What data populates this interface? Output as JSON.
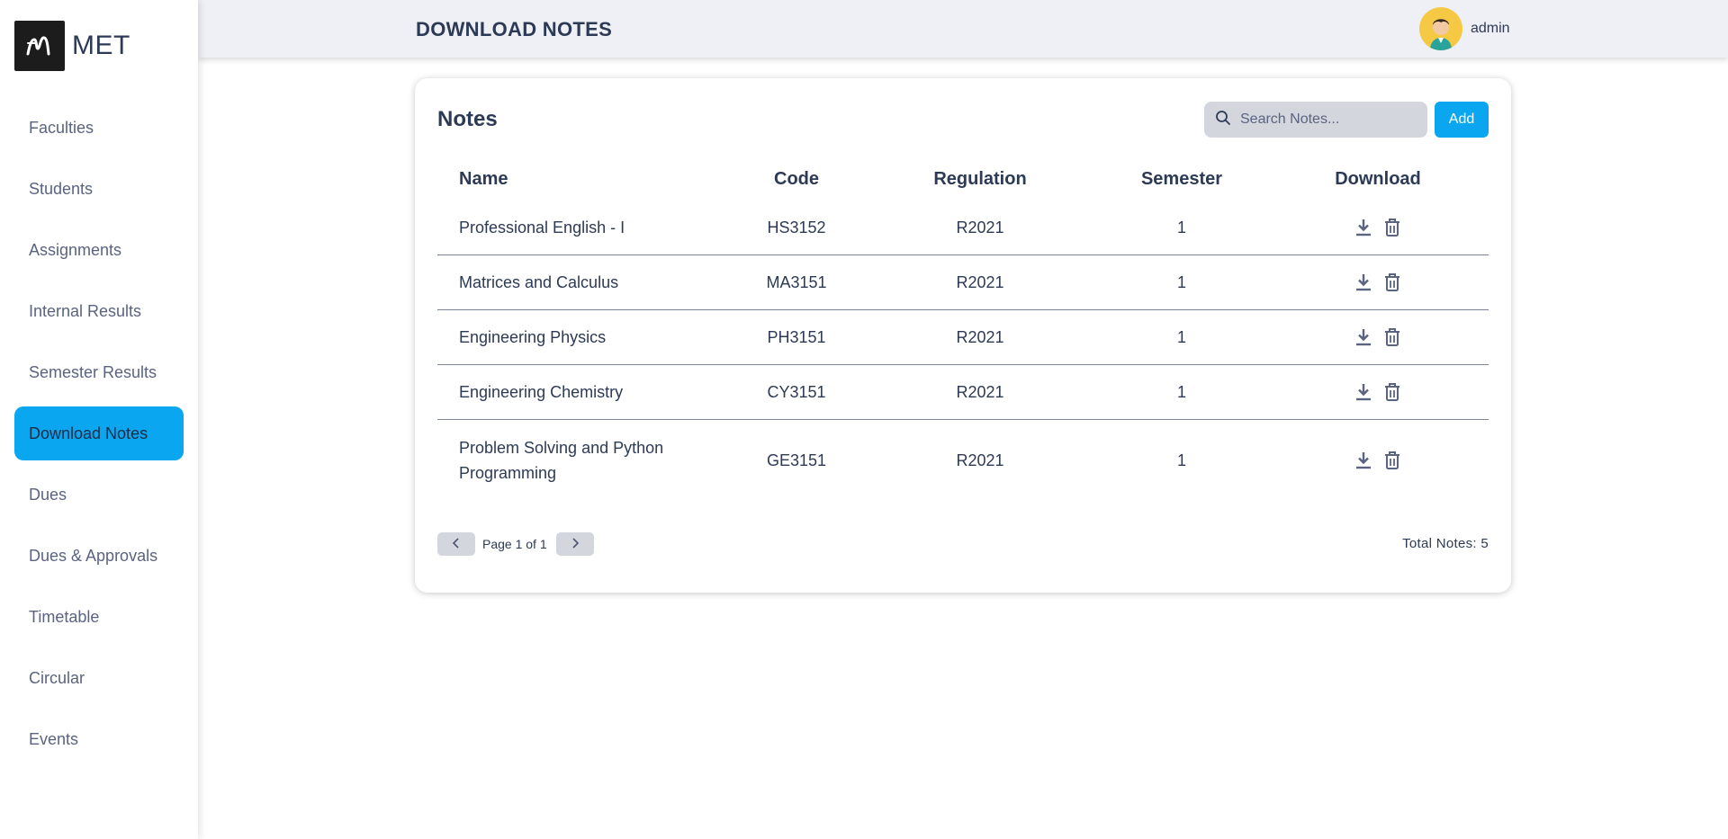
{
  "brand": {
    "name": "MET"
  },
  "sidebar": {
    "items": [
      {
        "label": "Faculties"
      },
      {
        "label": "Students"
      },
      {
        "label": "Assignments"
      },
      {
        "label": "Internal Results"
      },
      {
        "label": "Semester Results"
      },
      {
        "label": "Download Notes",
        "active": true
      },
      {
        "label": "Dues"
      },
      {
        "label": "Dues & Approvals"
      },
      {
        "label": "Timetable"
      },
      {
        "label": "Circular"
      },
      {
        "label": "Events"
      }
    ]
  },
  "header": {
    "title": "DOWNLOAD NOTES",
    "user_name": "admin"
  },
  "card": {
    "title": "Notes",
    "search_placeholder": "Search Notes...",
    "add_label": "Add"
  },
  "table": {
    "columns": [
      "Name",
      "Code",
      "Regulation",
      "Semester",
      "Download"
    ],
    "rows": [
      {
        "name": "Professional English - I",
        "code": "HS3152",
        "regulation": "R2021",
        "semester": "1"
      },
      {
        "name": "Matrices and Calculus",
        "code": "MA3151",
        "regulation": "R2021",
        "semester": "1"
      },
      {
        "name": "Engineering Physics",
        "code": "PH3151",
        "regulation": "R2021",
        "semester": "1"
      },
      {
        "name": "Engineering Chemistry",
        "code": "CY3151",
        "regulation": "R2021",
        "semester": "1"
      },
      {
        "name": "Problem Solving and Python Programming",
        "code": "GE3151",
        "regulation": "R2021",
        "semester": "1"
      }
    ]
  },
  "pagination": {
    "page_text": "Page 1 of 1",
    "total_text": "Total Notes: 5"
  },
  "icons": {
    "search": "search-icon",
    "download": "download-icon",
    "delete": "trash-icon",
    "prev": "chevron-left-icon",
    "next": "chevron-right-icon"
  },
  "colors": {
    "accent": "#0aa6ef",
    "text": "#2d3a55",
    "header_bg": "#eef0f5",
    "avatar_bg": "#f6c945"
  }
}
